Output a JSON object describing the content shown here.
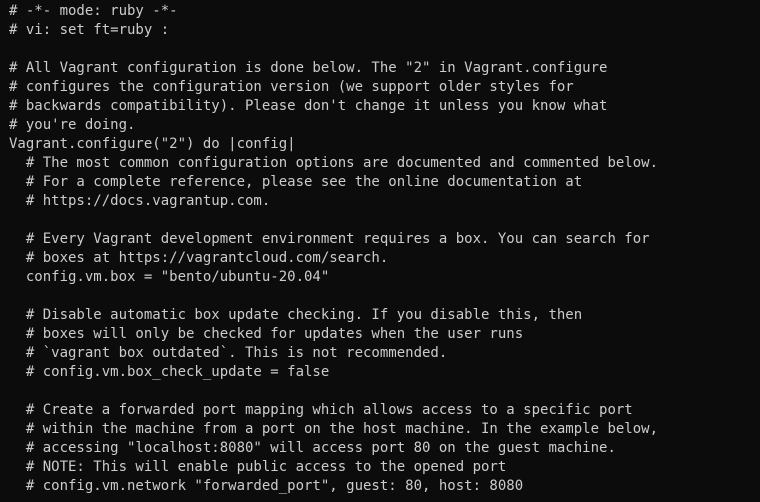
{
  "terminal": {
    "lines": [
      "# -*- mode: ruby -*-",
      "# vi: set ft=ruby :",
      "",
      "# All Vagrant configuration is done below. The \"2\" in Vagrant.configure",
      "# configures the configuration version (we support older styles for",
      "# backwards compatibility). Please don't change it unless you know what",
      "# you're doing.",
      "Vagrant.configure(\"2\") do |config|",
      "  # The most common configuration options are documented and commented below.",
      "  # For a complete reference, please see the online documentation at",
      "  # https://docs.vagrantup.com.",
      "",
      "  # Every Vagrant development environment requires a box. You can search for",
      "  # boxes at https://vagrantcloud.com/search.",
      "  config.vm.box = \"bento/ubuntu-20.04\"",
      "",
      "  # Disable automatic box update checking. If you disable this, then",
      "  # boxes will only be checked for updates when the user runs",
      "  # `vagrant box outdated`. This is not recommended.",
      "  # config.vm.box_check_update = false",
      "",
      "  # Create a forwarded port mapping which allows access to a specific port",
      "  # within the machine from a port on the host machine. In the example below,",
      "  # accessing \"localhost:8080\" will access port 80 on the guest machine.",
      "  # NOTE: This will enable public access to the opened port",
      "  # config.vm.network \"forwarded_port\", guest: 80, host: 8080"
    ],
    "colors": {
      "background": "#0c0c0c",
      "text": "#cccccc"
    }
  }
}
